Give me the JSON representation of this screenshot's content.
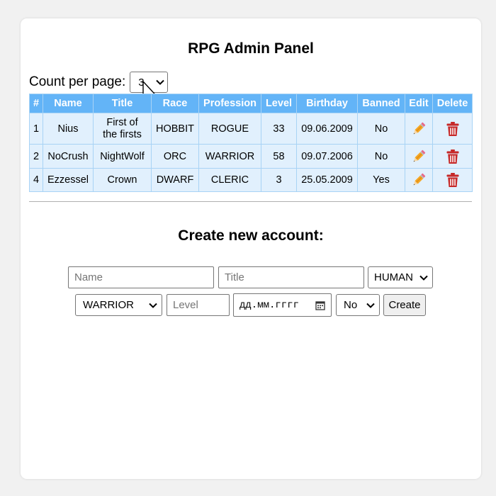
{
  "header": {
    "title": "RPG Admin Panel"
  },
  "pagination": {
    "count_label": "Count per page:",
    "count_value": "3"
  },
  "table": {
    "headers": {
      "num": "#",
      "name": "Name",
      "title": "Title",
      "race": "Race",
      "profession": "Profession",
      "level": "Level",
      "birthday": "Birthday",
      "banned": "Banned",
      "edit": "Edit",
      "delete": "Delete"
    },
    "rows": [
      {
        "num": "1",
        "name": "Nius",
        "title_line1": "First of",
        "title_line2": "the firsts",
        "race": "HOBBIT",
        "profession": "ROGUE",
        "level": "33",
        "birthday": "09.06.2009",
        "banned": "No"
      },
      {
        "num": "2",
        "name": "NoCrush",
        "title": "NightWolf",
        "race": "ORC",
        "profession": "WARRIOR",
        "level": "58",
        "birthday": "09.07.2006",
        "banned": "No"
      },
      {
        "num": "4",
        "name": "Ezzessel",
        "title": "Crown",
        "race": "DWARF",
        "profession": "CLERIC",
        "level": "3",
        "birthday": "25.05.2009",
        "banned": "Yes"
      }
    ],
    "edit_icon": "pencil-icon",
    "delete_icon": "trash-icon",
    "header_color": "#63b4f7",
    "row_color": "#e1f0fd"
  },
  "create_form": {
    "title": "Create new account:",
    "name_placeholder": "Name",
    "title_placeholder": "Title",
    "race_value": "HUMAN",
    "profession_value": "WARRIOR",
    "level_placeholder": "Level",
    "birthday_placeholder": "дд.мм.гггг",
    "banned_value": "No",
    "create_label": "Create"
  }
}
